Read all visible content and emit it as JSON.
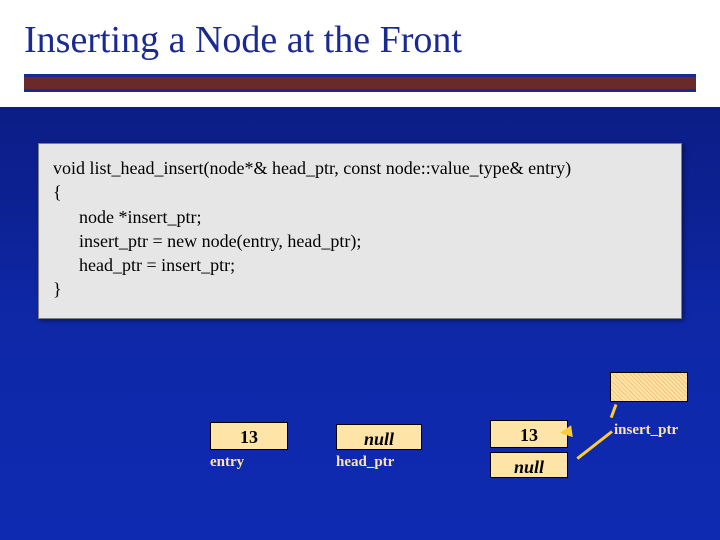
{
  "title": "Inserting a Node at the Front",
  "code": {
    "l1": "void list_head_insert(node*& head_ptr, const node::value_type& entry)",
    "l2": "{",
    "l3": "node *insert_ptr;",
    "l4": "",
    "l5": "insert_ptr = new node(entry, head_ptr);",
    "l6": "head_ptr = insert_ptr;",
    "l7": "}"
  },
  "diagram": {
    "entry_value": "13",
    "entry_label": "entry",
    "headptr_value": "null",
    "headptr_label": "head_ptr",
    "node_value": "13",
    "node_link": "null",
    "insertptr_label": "insert_ptr"
  }
}
